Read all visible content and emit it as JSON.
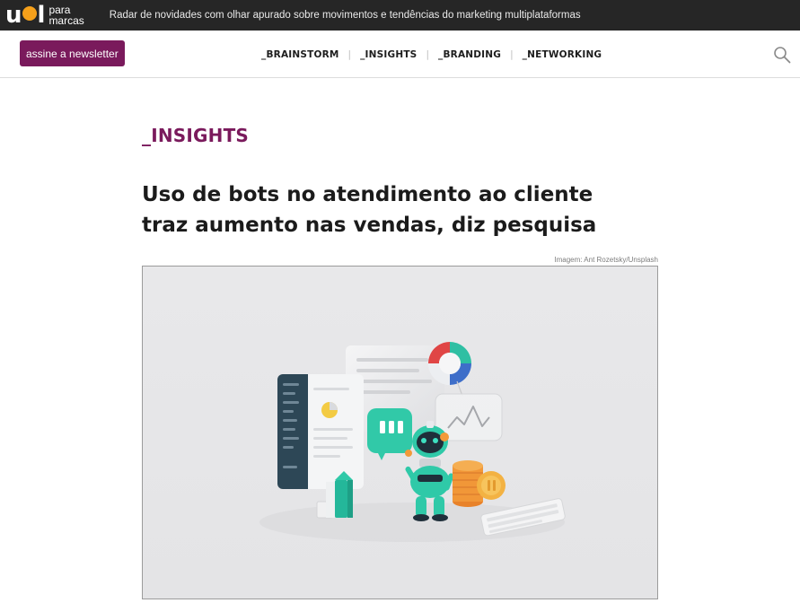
{
  "brand": {
    "logo_text": "uol",
    "logo_sub_line1": "para",
    "logo_sub_line2": "marcas",
    "tagline": "Radar de novidades com olhar apurado sobre movimentos e tendências do marketing multiplataformas"
  },
  "nav": {
    "newsletter_label": "assine a newsletter",
    "items": [
      {
        "label": "_BRAINSTORM"
      },
      {
        "label": "_INSIGHTS"
      },
      {
        "label": "_BRANDING"
      },
      {
        "label": "_NETWORKING"
      }
    ],
    "separator": "|",
    "search_icon": "search-icon"
  },
  "article": {
    "section": "_INSIGHTS",
    "title": "Uso de bots no atendimento ao cliente traz aumento nas vendas, diz pesquisa",
    "image_credit": "Imagem: Ant Rozetsky/Unsplash"
  },
  "colors": {
    "accent": "#7a1a5c",
    "topbar": "#262626",
    "logo_dot": "#f5a01a",
    "robot_teal": "#2ec4a6"
  }
}
